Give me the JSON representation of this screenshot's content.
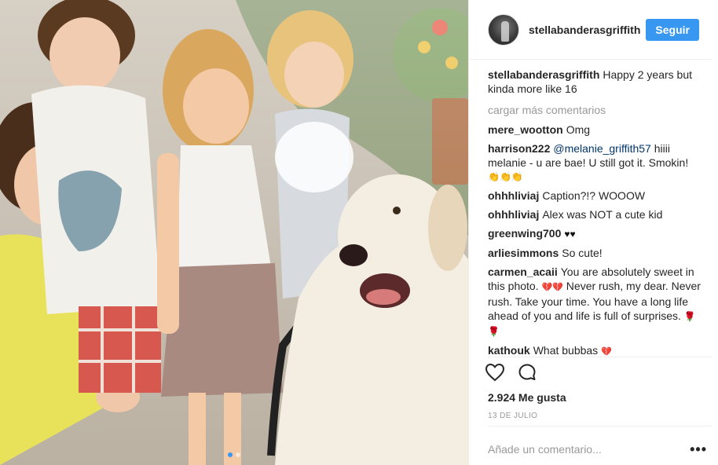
{
  "post": {
    "username": "stellabanderasgriffith",
    "follow_label": "Seguir",
    "caption": "Happy 2 years but kinda more like 16",
    "load_more_label": "cargar más comentarios",
    "likes": "2.924 Me gusta",
    "date": "13 DE JULIO",
    "comment_placeholder": "Añade un comentario...",
    "more_options": "•••"
  },
  "comments": [
    {
      "user": "mere_wootton",
      "text": "Omg"
    },
    {
      "user": "harrison222",
      "mention": "@melanie_griffith57",
      "text": " hiiii melanie - u are bae! U still got it. Smokin!",
      "emoji": "👏👏👏"
    },
    {
      "user": "ohhhliviaj",
      "text": "Caption?!? WOOOW"
    },
    {
      "user": "ohhhliviaj",
      "text": "Alex was NOT a cute kid"
    },
    {
      "user": "greenwing700",
      "text": "",
      "emoji": "♥♥"
    },
    {
      "user": "arliesimmons",
      "text": "So cute!"
    },
    {
      "user": "carmen_acaii",
      "text_before": "You are absolutely sweet in this photo.",
      "emoji_mid": "💔💔",
      "text_after": "Never rush, my dear. Never rush. Take your time. You have a long life ahead of you and life is full of surprises.",
      "emoji_end": "🌹 🌹"
    },
    {
      "user": "kathouk",
      "text": "What bubbas",
      "emoji": "💔"
    }
  ],
  "icons": {
    "like": "heart-outline-icon",
    "comment": "speech-bubble-icon"
  },
  "colors": {
    "follow_button": "#3897f0",
    "mention": "#003569",
    "muted": "#999999"
  }
}
